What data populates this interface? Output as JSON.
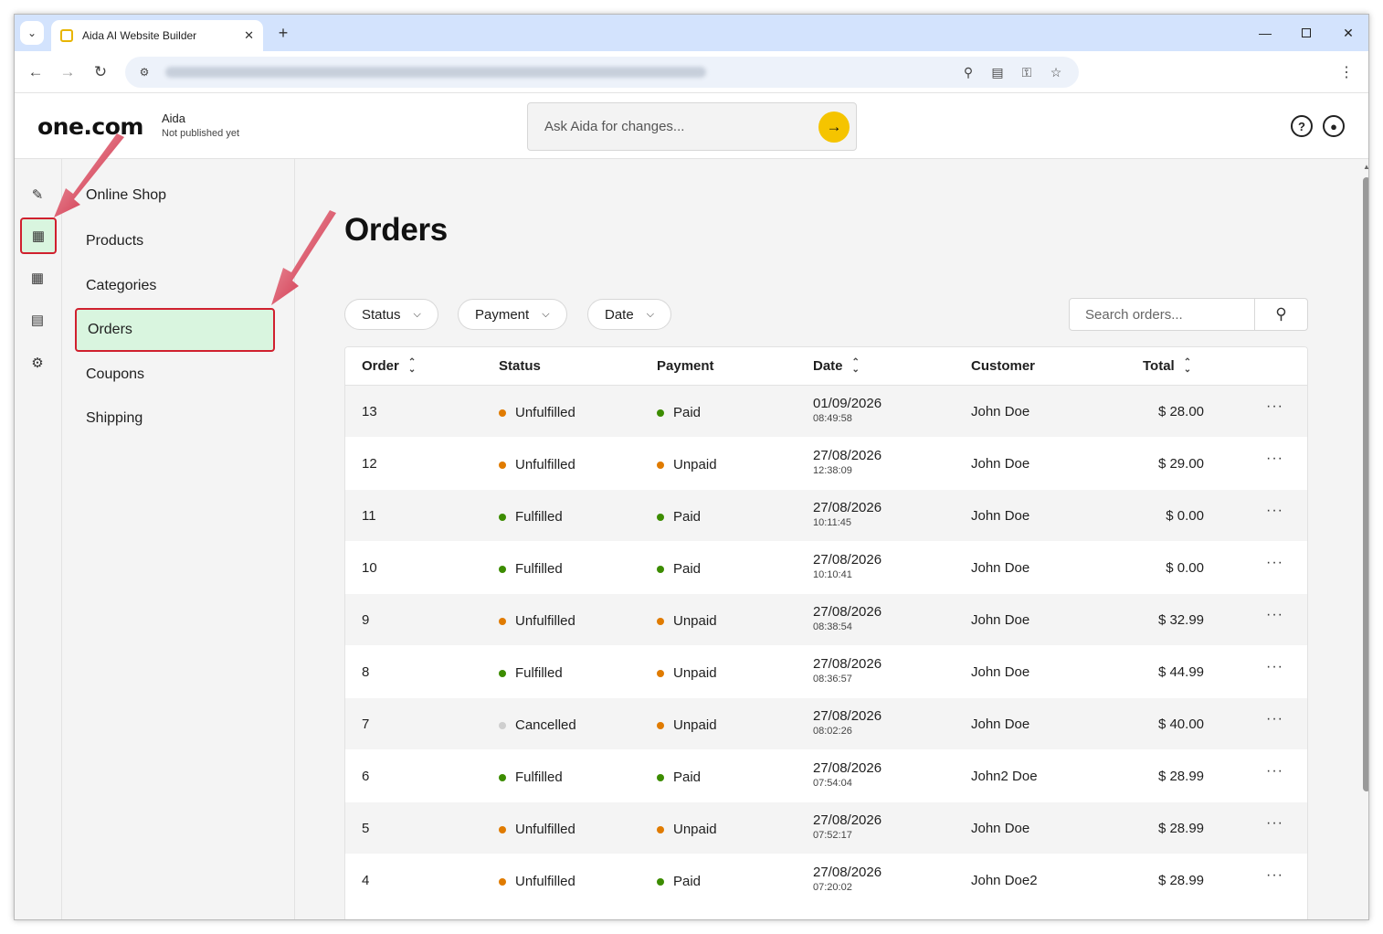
{
  "browser": {
    "tab_title": "Aida AI Website Builder",
    "new_tab_icon": "plus-icon",
    "close_icon": "close-icon"
  },
  "header": {
    "logo": "one.com",
    "site_name": "Aida",
    "site_status": "Not published yet",
    "ask_placeholder": "Ask Aida for changes..."
  },
  "subnav": {
    "section": "Online Shop",
    "items": [
      {
        "label": "Products"
      },
      {
        "label": "Categories"
      },
      {
        "label": "Orders",
        "active": true
      },
      {
        "label": "Coupons"
      },
      {
        "label": "Shipping"
      }
    ]
  },
  "main": {
    "title": "Orders",
    "filters": [
      {
        "label": "Status"
      },
      {
        "label": "Payment"
      },
      {
        "label": "Date"
      }
    ],
    "search_placeholder": "Search orders...",
    "columns": [
      "Order",
      "Status",
      "Payment",
      "Date",
      "Customer",
      "Total"
    ],
    "rows": [
      {
        "order": "13",
        "status": "Unfulfilled",
        "payment": "Paid",
        "date": "01/09/2026",
        "time": "08:49:58",
        "customer": "John Doe",
        "total": "$ 28.00"
      },
      {
        "order": "12",
        "status": "Unfulfilled",
        "payment": "Unpaid",
        "date": "27/08/2026",
        "time": "12:38:09",
        "customer": "John Doe",
        "total": "$ 29.00"
      },
      {
        "order": "11",
        "status": "Fulfilled",
        "payment": "Paid",
        "date": "27/08/2026",
        "time": "10:11:45",
        "customer": "John Doe",
        "total": "$ 0.00"
      },
      {
        "order": "10",
        "status": "Fulfilled",
        "payment": "Paid",
        "date": "27/08/2026",
        "time": "10:10:41",
        "customer": "John Doe",
        "total": "$ 0.00"
      },
      {
        "order": "9",
        "status": "Unfulfilled",
        "payment": "Unpaid",
        "date": "27/08/2026",
        "time": "08:38:54",
        "customer": "John Doe",
        "total": "$ 32.99"
      },
      {
        "order": "8",
        "status": "Fulfilled",
        "payment": "Unpaid",
        "date": "27/08/2026",
        "time": "08:36:57",
        "customer": "John Doe",
        "total": "$ 44.99"
      },
      {
        "order": "7",
        "status": "Cancelled",
        "payment": "Unpaid",
        "date": "27/08/2026",
        "time": "08:02:26",
        "customer": "John Doe",
        "total": "$ 40.00"
      },
      {
        "order": "6",
        "status": "Fulfilled",
        "payment": "Paid",
        "date": "27/08/2026",
        "time": "07:54:04",
        "customer": "John2 Doe",
        "total": "$ 28.99"
      },
      {
        "order": "5",
        "status": "Unfulfilled",
        "payment": "Unpaid",
        "date": "27/08/2026",
        "time": "07:52:17",
        "customer": "John Doe",
        "total": "$ 28.99"
      },
      {
        "order": "4",
        "status": "Unfulfilled",
        "payment": "Paid",
        "date": "27/08/2026",
        "time": "07:20:02",
        "customer": "John Doe2",
        "total": "$ 28.99"
      }
    ]
  },
  "colors": {
    "accent": "#f5c400",
    "unfulfilled": "#e07b00",
    "fulfilled": "#3c8c00",
    "cancelled": "#cfcfcf",
    "paid": "#3c8c00",
    "unpaid": "#e07b00",
    "highlight": "#d0202e",
    "active_bg": "#d9f5df"
  }
}
